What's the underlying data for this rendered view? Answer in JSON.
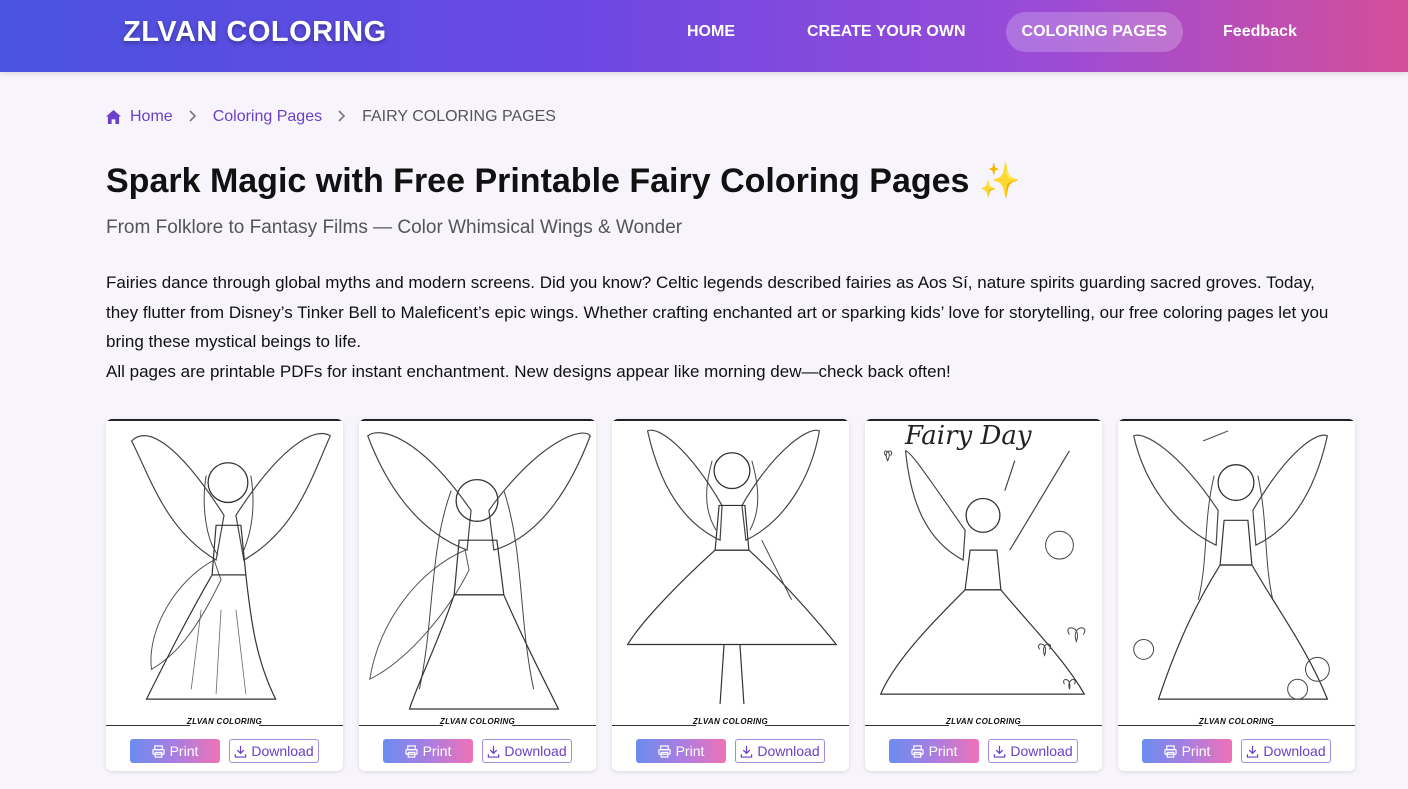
{
  "header": {
    "logo": "ZLVAN COLORING",
    "nav": [
      {
        "label": "HOME",
        "active": false
      },
      {
        "label": "CREATE YOUR OWN",
        "active": false
      },
      {
        "label": "COLORING PAGES",
        "active": true
      },
      {
        "label": "Feedback",
        "active": false
      }
    ]
  },
  "breadcrumb": {
    "home": "Home",
    "section": "Coloring Pages",
    "current": "FAIRY COLORING PAGES",
    "home_icon": "home-icon",
    "separator_icon": "chevron-right-icon"
  },
  "main": {
    "title": "Spark Magic with Free Printable Fairy Coloring Pages ✨",
    "subtitle": "From Folklore to Fantasy Films — Color Whimsical Wings & Wonder",
    "intro_lines": [
      "Fairies dance through global myths and modern screens. Did you know? Celtic legends described fairies as Aos Sí, nature spirits guarding sacred groves. Today, they flutter from Disney’s Tinker Bell to Maleficent’s epic wings. Whether crafting enchanted art or sparking kids’ love for storytelling, our free coloring pages let you bring these mystical beings to life.",
      "All pages are printable PDFs for instant enchantment. New designs appear like morning dew—check back often!"
    ]
  },
  "cards": [
    {
      "brand": "ZLVAN COLORING",
      "print_label": "Print",
      "download_label": "Download",
      "image_text": ""
    },
    {
      "brand": "ZLVAN COLORING",
      "print_label": "Print",
      "download_label": "Download",
      "image_text": ""
    },
    {
      "brand": "ZLVAN COLORING",
      "print_label": "Print",
      "download_label": "Download",
      "image_text": ""
    },
    {
      "brand": "ZLVAN COLORING",
      "print_label": "Print",
      "download_label": "Download",
      "image_text": "Fairy Day"
    },
    {
      "brand": "ZLVAN COLORING",
      "print_label": "Print",
      "download_label": "Download",
      "image_text": ""
    }
  ],
  "colors": {
    "header_gradient_start": "#4a52e0",
    "header_gradient_end": "#d44f9a",
    "link_purple": "#6b3fc8",
    "page_background": "#f7f5fb"
  }
}
